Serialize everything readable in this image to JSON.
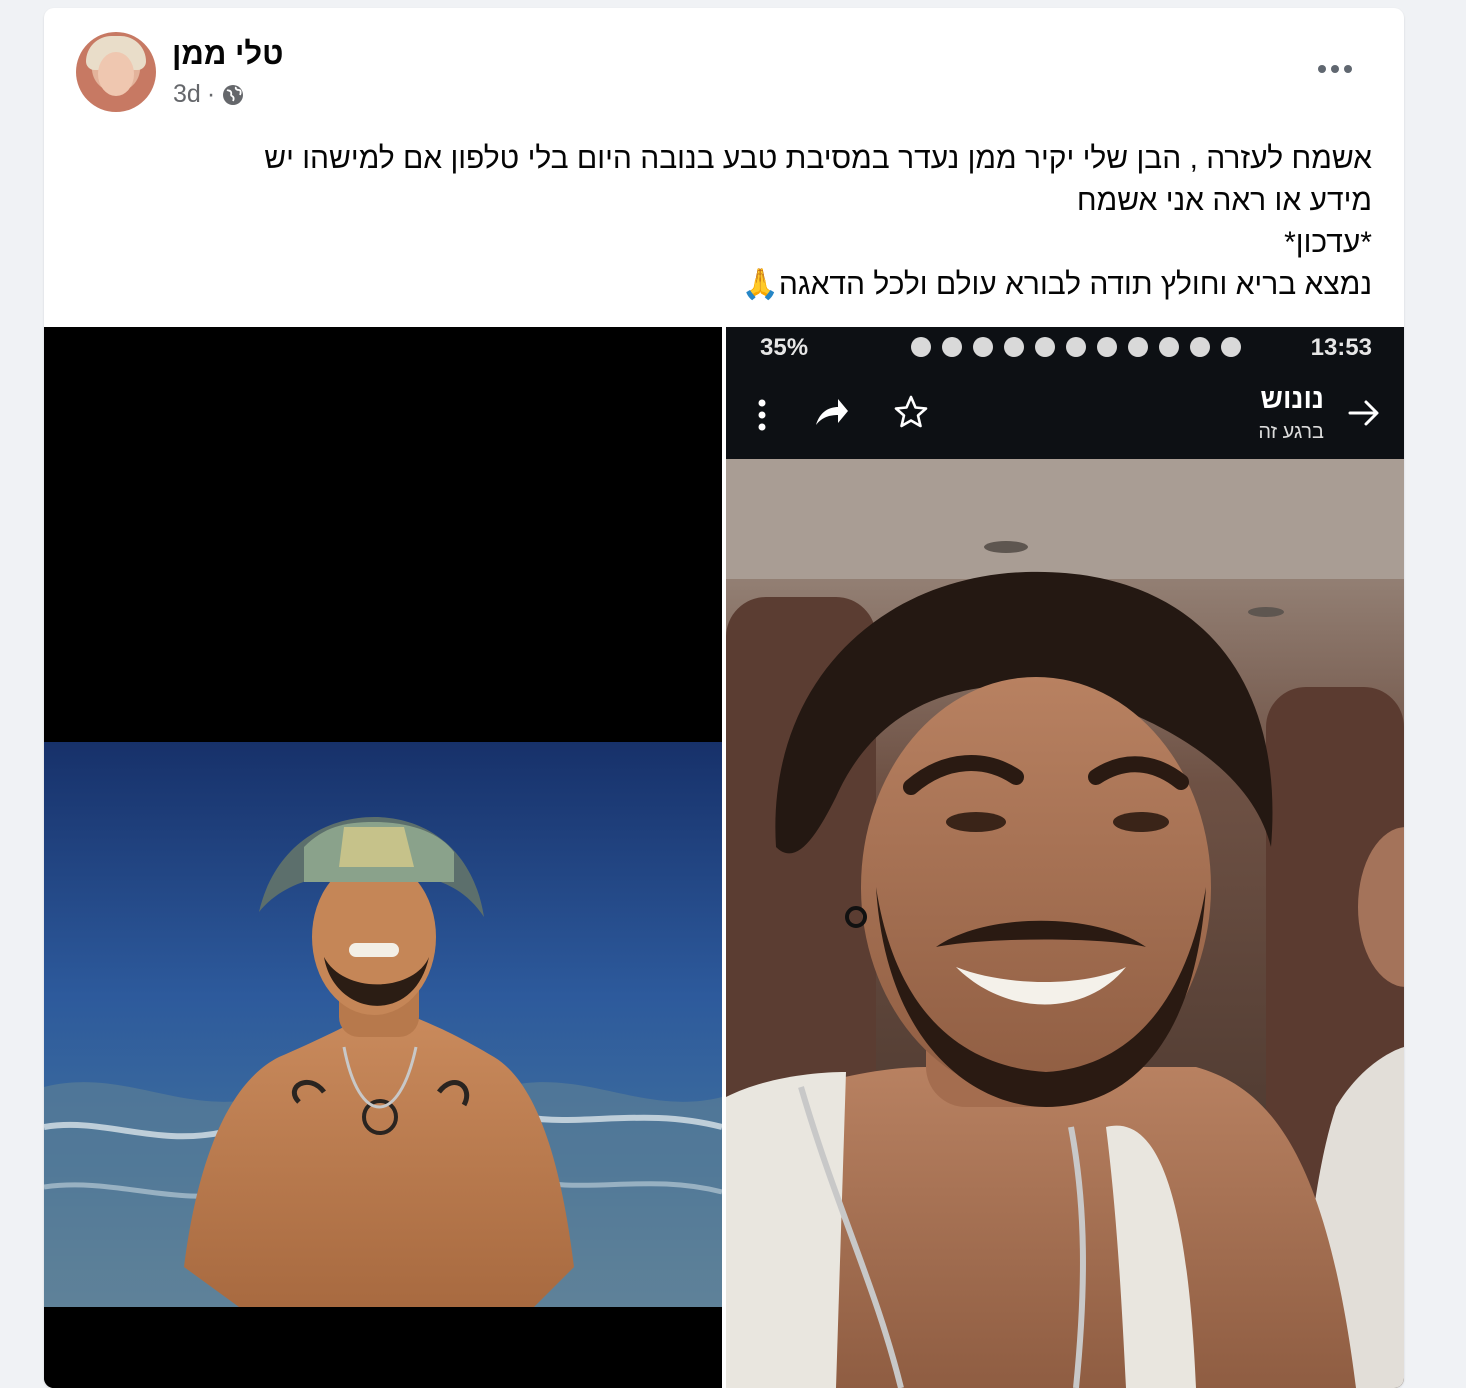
{
  "post": {
    "author_name": "טלי ממן",
    "timestamp": "3d",
    "separator": "·",
    "audience_icon": "globe-icon",
    "more_icon": "ellipsis-icon",
    "text_lines": [
      "אשמח לעזרה , הבן שלי יקיר ממן נעדר במסיבת טבע בנובה היום בלי טלפון אם למישהו יש",
      "מידע או ראה אני אשמח",
      "*עדכון*",
      "נמצא בריא וחולץ תודה לבורא עולם ולכל הדאגה🙏"
    ]
  },
  "photos": {
    "left": {
      "description_icon": "photo-beach"
    },
    "right": {
      "status_bar": {
        "battery": "35%",
        "clock": "13:53"
      },
      "chat_header": {
        "contact_name": "נונוש",
        "contact_status": "ברגע זה",
        "back_icon": "arrow-right-icon",
        "star_icon": "star-icon",
        "share_icon": "share-icon",
        "menu_icon": "kebab-menu-icon"
      }
    }
  },
  "colors": {
    "name": "#050505",
    "meta": "#65676b",
    "card_bg": "#ffffff",
    "page_bg": "#f0f2f5"
  }
}
